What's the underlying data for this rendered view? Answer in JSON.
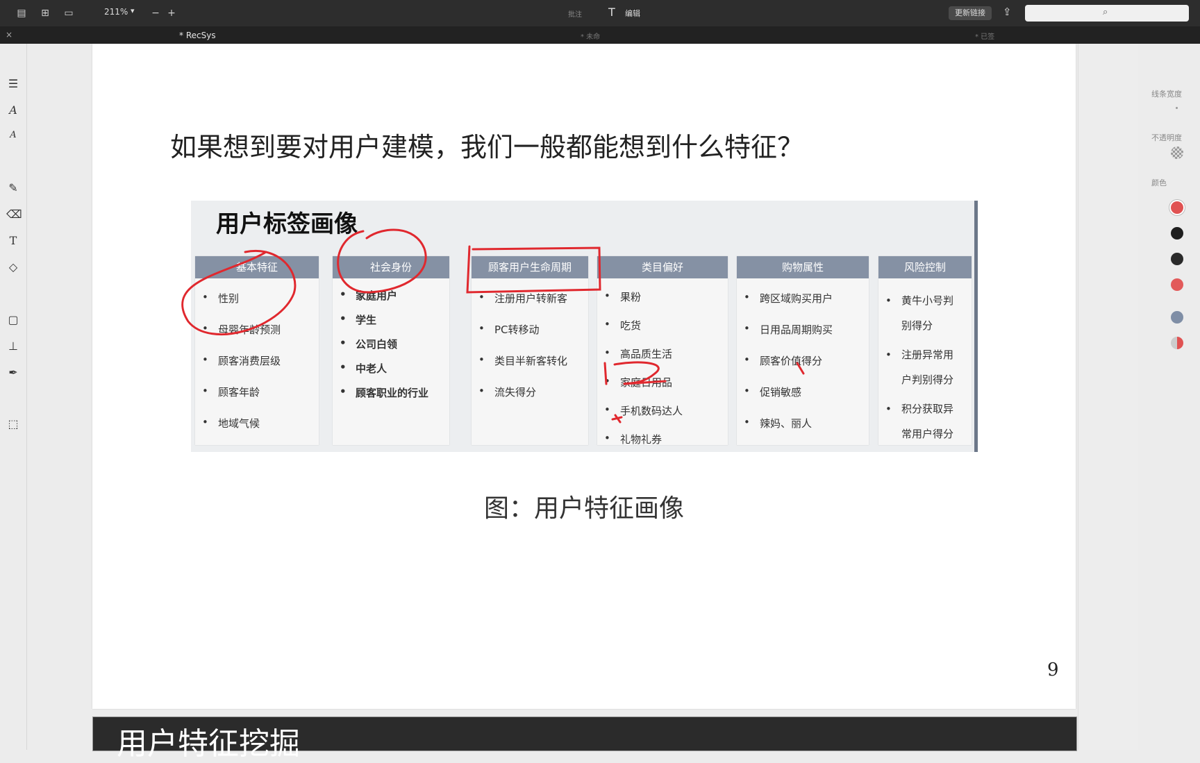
{
  "toolbar": {
    "zoom": "211%",
    "zoom_minus": "−",
    "zoom_plus": "+",
    "mid_label": "批注",
    "edit_label": "编辑",
    "update_btn": "更新链接"
  },
  "tabbar": {
    "title": "* RecSys",
    "mid": "* 未命",
    "right": "* 已签"
  },
  "right_panel": {
    "stroke_label": "线条宽度",
    "opacity_label": "不透明度",
    "color_label": "颜色",
    "colors": [
      "#e05252",
      "#1e1e1e",
      "#2a2a2a",
      "#e25a5a",
      "#7f8ea6",
      "#c0c0c0"
    ]
  },
  "slide": {
    "question": "如果想到要对用户建模，我们一般都能想到什么特征？",
    "figure_title": "用户标签画像",
    "columns": [
      {
        "header": "基本特征",
        "items": [
          "性别",
          "母婴年龄预测",
          "顾客消费层级",
          "顾客年龄",
          "地域气候"
        ]
      },
      {
        "header": "社会身份",
        "items": [
          "家庭用户",
          "学生",
          "公司白领",
          "中老人",
          "顾客职业的行业"
        ]
      },
      {
        "header": "顾客用户生命周期",
        "items": [
          "注册用户转新客",
          "PC转移动",
          "类目半新客转化",
          "流失得分"
        ]
      },
      {
        "header": "类目偏好",
        "items": [
          "果粉",
          "吃货",
          "高品质生活",
          "家庭日用品",
          "手机数码达人",
          "礼物礼券"
        ]
      },
      {
        "header": "购物属性",
        "items": [
          "跨区域购买用户",
          "日用品周期购买",
          "顾客价值得分",
          "促销敏感",
          "辣妈、丽人"
        ]
      },
      {
        "header": "风险控制",
        "items": [
          "黄牛小号判别得分",
          "注册异常用户判别得分",
          "积分获取异常用户得分"
        ]
      }
    ],
    "caption": "图：用户特征画像",
    "page_number": "9"
  },
  "next_slide": {
    "title": "用户特征挖掘"
  }
}
